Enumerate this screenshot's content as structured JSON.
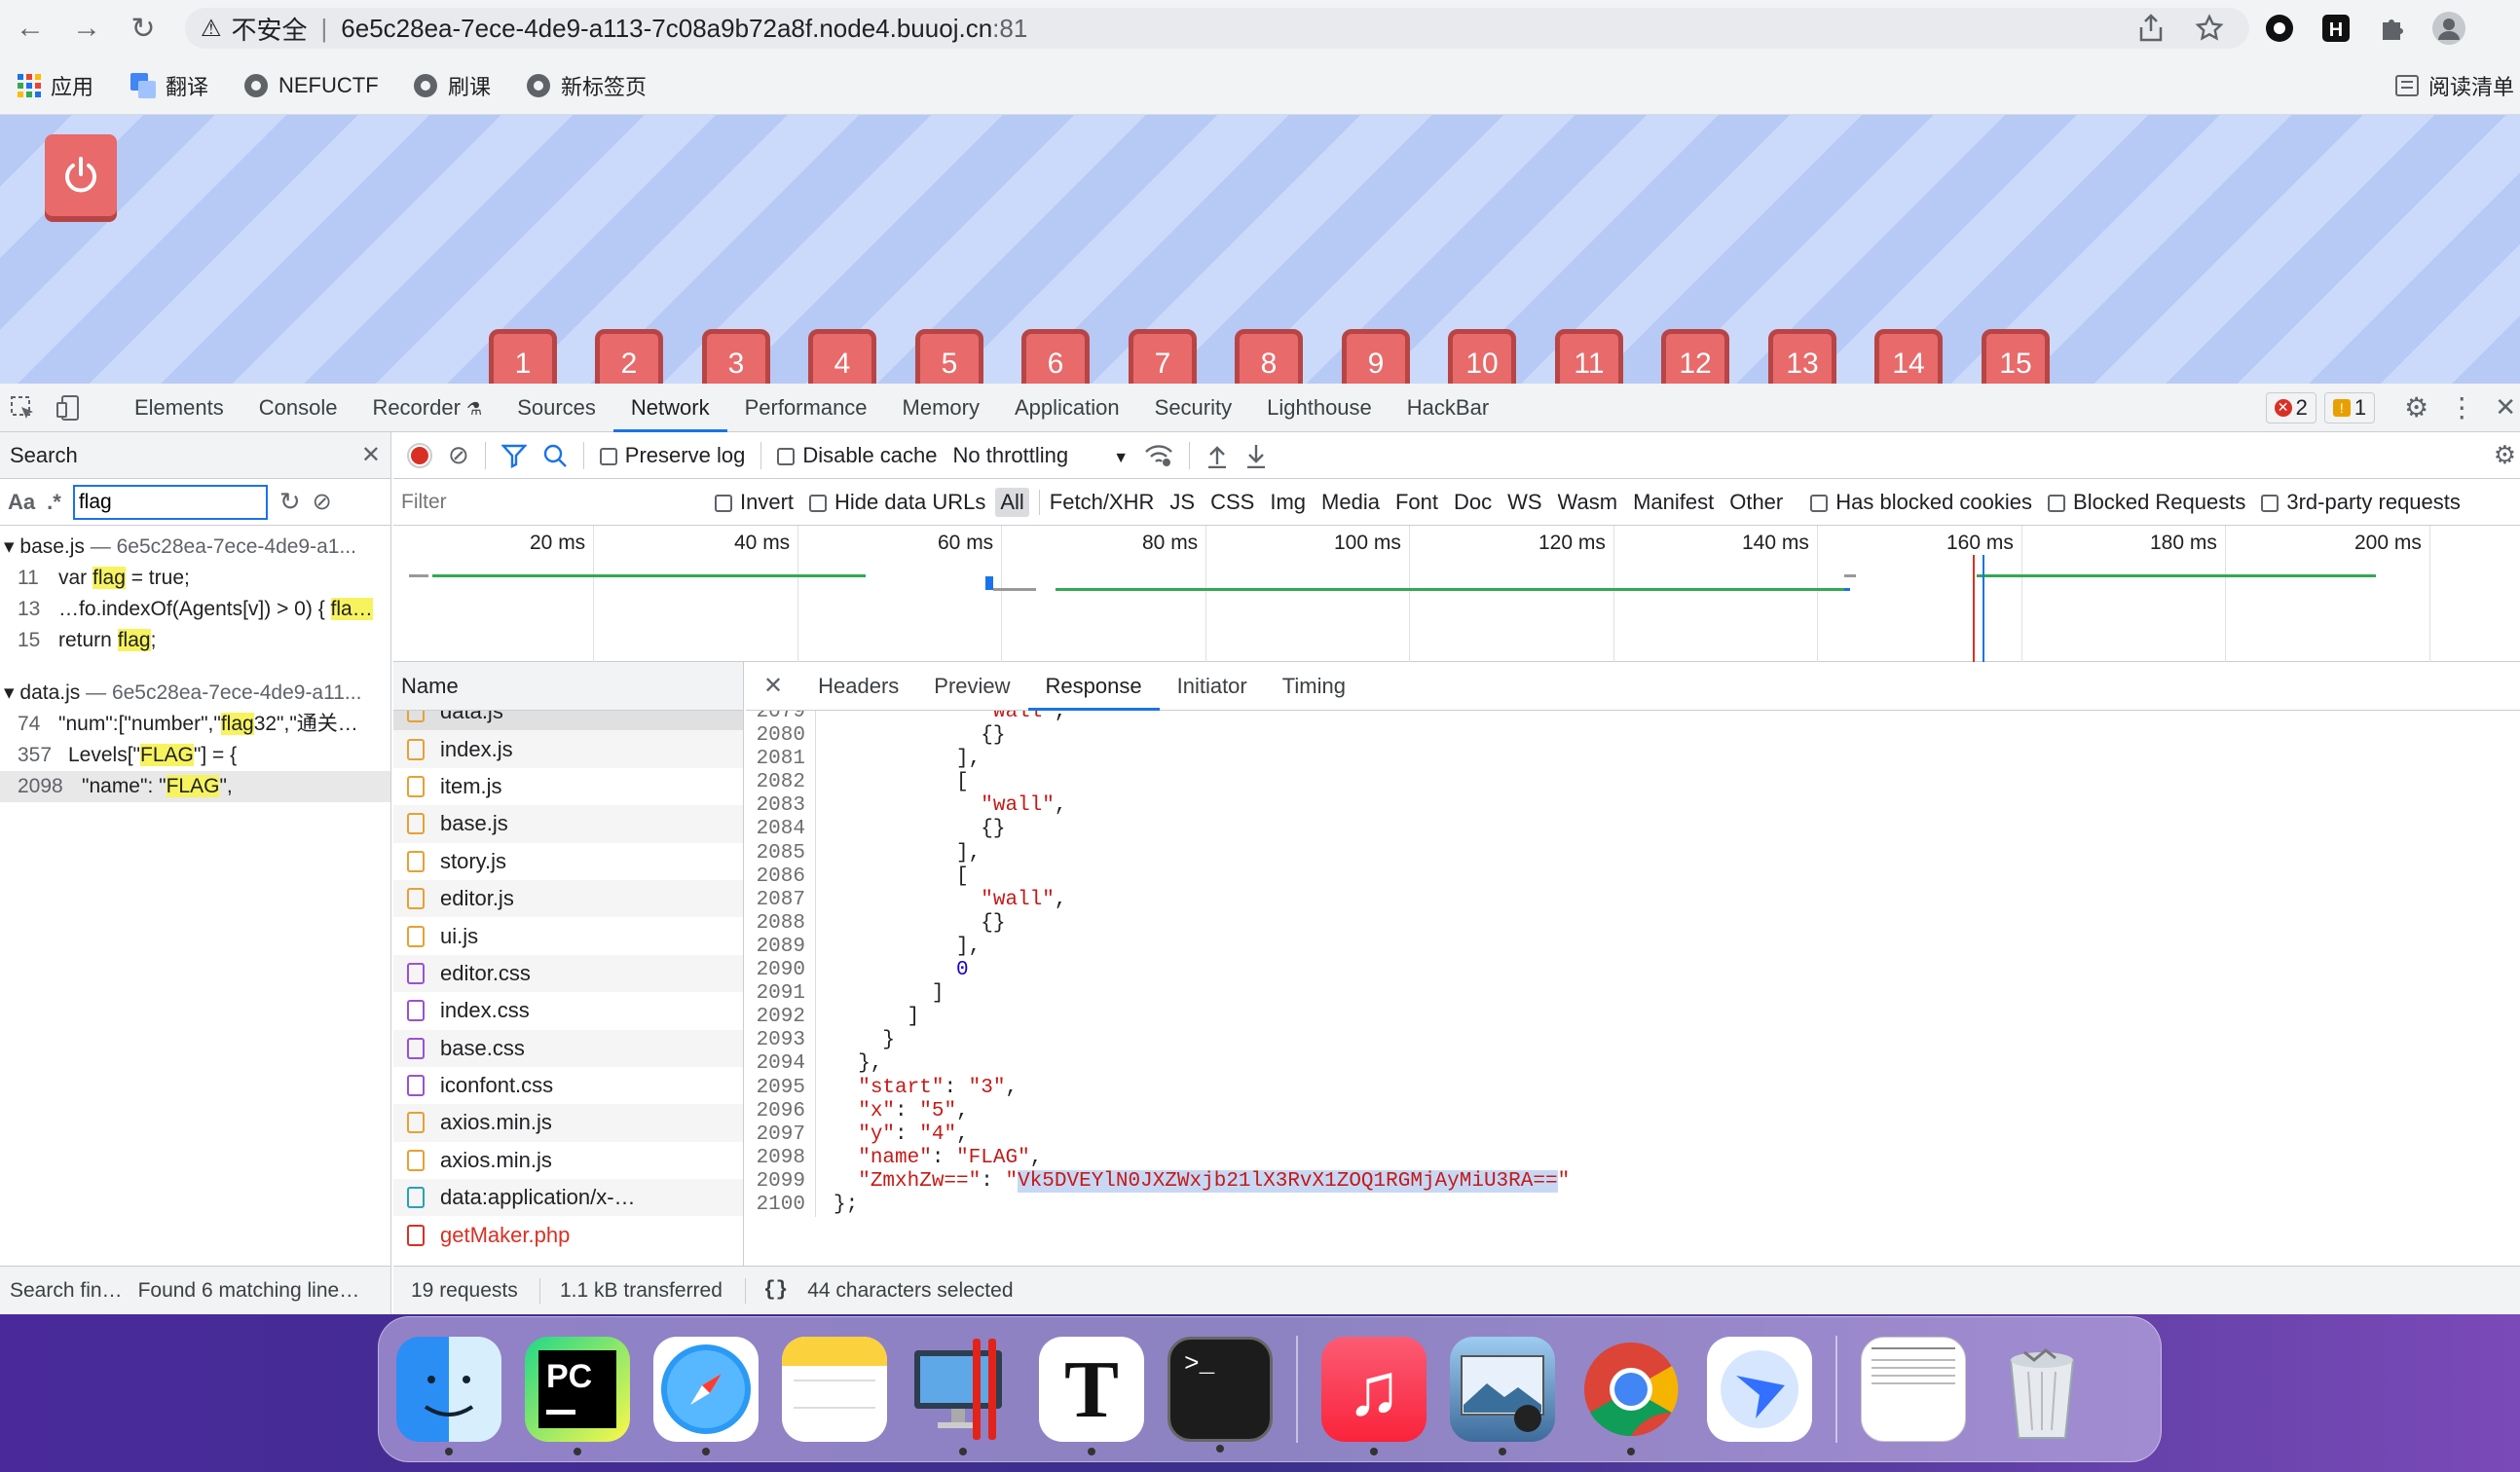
{
  "browser": {
    "security_label": "不安全",
    "url_host": "6e5c28ea-7ece-4de9-a113-7c08a9b72a8f.node4.buuoj.cn",
    "url_port": ":81",
    "bookmarks": [
      "应用",
      "翻译",
      "NEFUCTF",
      "刷课",
      "新标签页"
    ],
    "reading_list": "阅读清单"
  },
  "page": {
    "levels": [
      "1",
      "2",
      "3",
      "4",
      "5",
      "6",
      "7",
      "8",
      "9",
      "10",
      "11",
      "12",
      "13",
      "14",
      "15"
    ]
  },
  "devtools": {
    "tabs": [
      "Elements",
      "Console",
      "Recorder",
      "Sources",
      "Network",
      "Performance",
      "Memory",
      "Application",
      "Security",
      "Lighthouse",
      "HackBar"
    ],
    "active_tab": "Network",
    "error_count": "2",
    "warning_count": "1",
    "search": {
      "title": "Search",
      "aa": "Aa",
      "regex": ".*",
      "query": "flag",
      "results": [
        {
          "file": "base.js",
          "path": "— 6e5c28ea-7ece-4de9-a1...",
          "lines": [
            {
              "n": "11",
              "pre": "var ",
              "hit": "flag",
              "post": " = true;"
            },
            {
              "n": "13",
              "pre": "…fo.indexOf(Agents[v]) > 0) { ",
              "hit": "fla…",
              "post": ""
            },
            {
              "n": "15",
              "pre": "return ",
              "hit": "flag",
              "post": ";"
            }
          ]
        },
        {
          "file": "data.js",
          "path": "— 6e5c28ea-7ece-4de9-a11...",
          "lines": [
            {
              "n": "74",
              "pre": "\"num\":[\"number\",\"",
              "hit": "flag",
              "post": "32\",\"通关…"
            },
            {
              "n": "357",
              "pre": "Levels[\"",
              "hit": "FLAG",
              "post": "\"] = {"
            },
            {
              "n": "2098",
              "pre": "\"name\": \"",
              "hit": "FLAG",
              "post": "\","
            }
          ]
        }
      ],
      "status_left": "Search fin…",
      "status_right": "Found 6 matching line…"
    },
    "network": {
      "preserve_log": "Preserve log",
      "disable_cache": "Disable cache",
      "throttling": "No throttling",
      "filter_placeholder": "Filter",
      "invert": "Invert",
      "hide_data_urls": "Hide data URLs",
      "types": [
        "All",
        "Fetch/XHR",
        "JS",
        "CSS",
        "Img",
        "Media",
        "Font",
        "Doc",
        "WS",
        "Wasm",
        "Manifest",
        "Other"
      ],
      "has_blocked_cookies": "Has blocked cookies",
      "blocked_requests": "Blocked Requests",
      "third_party": "3rd-party requests",
      "timeline_ticks": [
        "20 ms",
        "40 ms",
        "60 ms",
        "80 ms",
        "100 ms",
        "120 ms",
        "140 ms",
        "160 ms",
        "180 ms",
        "200 ms"
      ],
      "name_header": "Name",
      "files": [
        {
          "name": "data.js",
          "type": "js"
        },
        {
          "name": "index.js",
          "type": "js"
        },
        {
          "name": "item.js",
          "type": "js"
        },
        {
          "name": "base.js",
          "type": "js"
        },
        {
          "name": "story.js",
          "type": "js"
        },
        {
          "name": "editor.js",
          "type": "js"
        },
        {
          "name": "ui.js",
          "type": "js"
        },
        {
          "name": "editor.css",
          "type": "css"
        },
        {
          "name": "index.css",
          "type": "css"
        },
        {
          "name": "base.css",
          "type": "css"
        },
        {
          "name": "iconfont.css",
          "type": "css"
        },
        {
          "name": "axios.min.js",
          "type": "js"
        },
        {
          "name": "axios.min.js",
          "type": "js"
        },
        {
          "name": "data:application/x-…",
          "type": "doc"
        },
        {
          "name": "getMaker.php",
          "type": "php"
        }
      ],
      "detail_tabs": [
        "Headers",
        "Preview",
        "Response",
        "Initiator",
        "Timing"
      ],
      "active_detail_tab": "Response",
      "requests": "19 requests",
      "transferred": "1.1 kB transferred",
      "selection": "44 characters selected"
    },
    "response_lines": [
      {
        "n": "2079",
        "t": "            \"wall\","
      },
      {
        "n": "2080",
        "t": "            {}"
      },
      {
        "n": "2081",
        "t": "          ],"
      },
      {
        "n": "2082",
        "t": "          ["
      },
      {
        "n": "2083",
        "t": "            \"wall\","
      },
      {
        "n": "2084",
        "t": "            {}"
      },
      {
        "n": "2085",
        "t": "          ],"
      },
      {
        "n": "2086",
        "t": "          ["
      },
      {
        "n": "2087",
        "t": "            \"wall\","
      },
      {
        "n": "2088",
        "t": "            {}"
      },
      {
        "n": "2089",
        "t": "          ],"
      },
      {
        "n": "2090",
        "t": "          0"
      },
      {
        "n": "2091",
        "t": "        ]"
      },
      {
        "n": "2092",
        "t": "      ]"
      },
      {
        "n": "2093",
        "t": "    }"
      },
      {
        "n": "2094",
        "t": "  },"
      },
      {
        "n": "2095",
        "t": "  \"start\": \"3\","
      },
      {
        "n": "2096",
        "t": "  \"x\": \"5\","
      },
      {
        "n": "2097",
        "t": "  \"y\": \"4\","
      },
      {
        "n": "2098",
        "t": "  \"name\": \"FLAG\","
      },
      {
        "n": "2099",
        "t": "  \"ZmxhZw==\": \"Vk5DVEYlN0JXZWxjb21lX3RvX1ZOQ1RGMjAyMiU3RA==\""
      },
      {
        "n": "2100",
        "t": "};"
      }
    ]
  },
  "dock": {
    "apps": [
      "finder-icon",
      "pycharm-icon",
      "safari-icon",
      "notes-icon",
      "parallels-icon",
      "typora-icon",
      "terminal-icon",
      "music-icon",
      "preview-icon",
      "chrome-icon",
      "feishu-icon",
      "document-thumbnail-icon",
      "trash-icon"
    ]
  }
}
